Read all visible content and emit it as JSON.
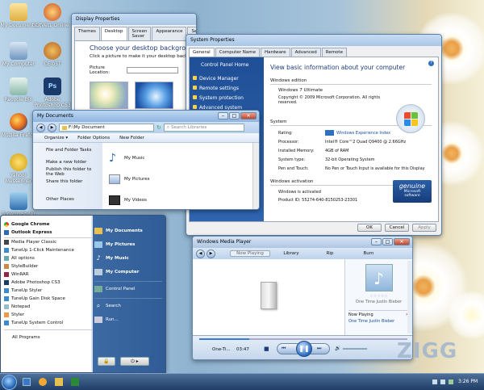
{
  "desktop": {
    "icons": [
      {
        "label": "My Documents"
      },
      {
        "label": "GtVet1 Online"
      },
      {
        "label": "My Computer"
      },
      {
        "label": "CE 03T"
      },
      {
        "label": "Recycle Bin"
      },
      {
        "label": "Adobe Photoshop CS3"
      },
      {
        "label": "Mozilla Firefox"
      },
      {
        "label": "Yahoo! Messenger"
      },
      {
        "label": "TuneUp Styler"
      }
    ],
    "watermark": "ZIGG"
  },
  "display_properties": {
    "title": "Display Properties",
    "tabs": [
      "Themes",
      "Desktop",
      "Screen Saver",
      "Appearance",
      "Settings"
    ],
    "heading": "Choose your desktop background",
    "subtext": "Click a picture to make it your desktop background",
    "location_label": "Picture Location:"
  },
  "system_properties": {
    "title": "System Properties",
    "tabs": [
      "General",
      "Computer Name",
      "Hardware",
      "Advanced",
      "Remote"
    ],
    "side": {
      "home": "Control Panel Home",
      "links": [
        "Device Manager",
        "Remote settings",
        "System protection",
        "Advanced system settings"
      ]
    },
    "heading": "View basic information about your computer",
    "edition_header": "Windows edition",
    "edition": "Windows 7 Ultimate",
    "copyright": "Copyright © 2009 Microsoft Corporation. All rights reserved.",
    "system_header": "System",
    "rows": [
      {
        "label": "Rating:",
        "value": "Windows Experience Index"
      },
      {
        "label": "Processor:",
        "value": "Intel® Core™2 Quad Q9400 @ 2.66GHz"
      },
      {
        "label": "Installed Memory:",
        "value": "4GB of RAM"
      },
      {
        "label": "System type:",
        "value": "32-bit Operating System"
      },
      {
        "label": "Pen and Touch:",
        "value": "No Pen or Touch Input is available for this Display"
      }
    ],
    "activation_header": "Windows activation",
    "activation_status": "Windows is activated",
    "product_id": "Product ID: 55274-640-8150253-23301",
    "genuine_line1": "genuine",
    "genuine_line2": "Microsoft",
    "genuine_line3": "software",
    "buttons": {
      "ok": "OK",
      "cancel": "Cancel",
      "apply": "Apply"
    }
  },
  "explorer": {
    "title": "My Documents",
    "path": "F:\\My Document",
    "search_placeholder": "Search Libraries",
    "toolbar": [
      "Organize ▾",
      "Folder Options",
      "New Folder"
    ],
    "tasks_header": "File and Folder Tasks",
    "tasks": [
      "Make a new folder",
      "Publish this folder to the Web",
      "Share this folder"
    ],
    "other_places": "Other Places",
    "items": [
      "My Music",
      "My Pictures",
      "My Videos"
    ]
  },
  "start_menu": {
    "programs": [
      "Google Chrome",
      "Outlook Express",
      "Media Player Classic",
      "TuneUp 1-Click Maintenance",
      "All options",
      "StyleBuilder",
      "WinRAR",
      "Adobe Photoshop CS3",
      "TuneUp Styler",
      "TuneUp Gain Disk Space",
      "Notepad",
      "Styler",
      "TuneUp System Control"
    ],
    "all_programs": "All Programs",
    "right": [
      "My Documents",
      "My Pictures",
      "My Music",
      "My Computer",
      "Control Panel",
      "Search",
      "Run..."
    ]
  },
  "media_player": {
    "title": "Windows Media Player",
    "tabs": [
      "Now Playing",
      "Library",
      "Rip",
      "Burn"
    ],
    "track": "One Time Justin Bieber",
    "rating": "☆☆☆☆☆",
    "now_playing": "Now Playing",
    "queue_item": "One Time Justin Bieber",
    "status_track": "One-Ti...",
    "time": "03:47"
  },
  "taskbar": {
    "clock": "3:26 PM"
  }
}
